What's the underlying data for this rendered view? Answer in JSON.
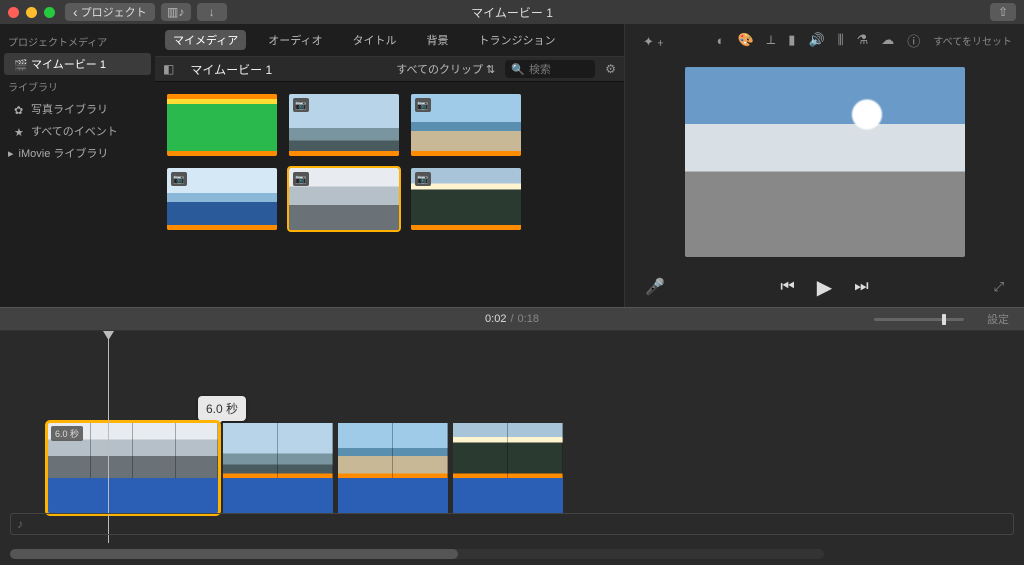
{
  "titlebar": {
    "back": "プロジェクト",
    "title": "マイムービー 1"
  },
  "sidebar": {
    "project_media": "プロジェクトメディア",
    "movie_item": "マイムービー 1",
    "libraries": "ライブラリ",
    "photos": "写真ライブラリ",
    "all_events": "すべてのイベント",
    "imovie_lib": "iMovie ライブラリ"
  },
  "tabs": {
    "mymedia": "マイメディア",
    "audio": "オーディオ",
    "titles": "タイトル",
    "backgrounds": "背景",
    "transitions": "トランジション"
  },
  "subbar": {
    "project": "マイムービー 1",
    "all_clips": "すべてのクリップ",
    "search_ph": "検索"
  },
  "preview_tools": {
    "reset": "すべてをリセット"
  },
  "timeline": {
    "current": "0:02",
    "total": "0:18",
    "settings": "設定",
    "tooltip": "6.0 秒",
    "clip_badge": "6.0 秒"
  }
}
